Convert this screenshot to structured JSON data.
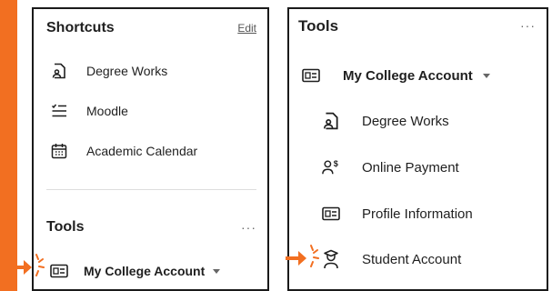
{
  "colors": {
    "accent": "#f26f21",
    "frame": "#1a1a1a",
    "text": "#1f1f1f"
  },
  "shortcuts": {
    "title": "Shortcuts",
    "edit_label": "Edit",
    "items": [
      {
        "label": "Degree Works",
        "icon": "document-person-icon"
      },
      {
        "label": "Moodle",
        "icon": "checklist-icon"
      },
      {
        "label": "Academic Calendar",
        "icon": "calendar-icon"
      }
    ]
  },
  "tools_left": {
    "title": "Tools",
    "more": "···",
    "account_label": "My College Account"
  },
  "tools_right": {
    "title": "Tools",
    "more": "···",
    "account_label": "My College Account",
    "items": [
      {
        "label": "Degree Works",
        "icon": "document-person-icon"
      },
      {
        "label": "Online Payment",
        "icon": "person-dollar-icon"
      },
      {
        "label": "Profile Information",
        "icon": "id-card-icon"
      },
      {
        "label": "Student Account",
        "icon": "graduate-icon"
      }
    ]
  }
}
